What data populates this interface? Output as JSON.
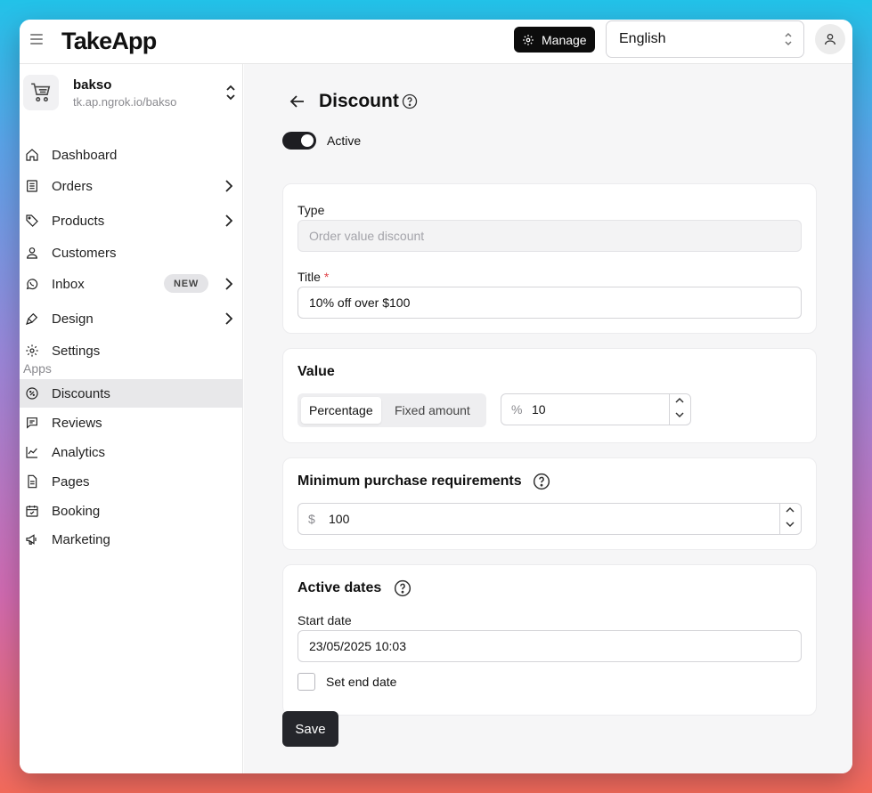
{
  "app": {
    "logo": "TakeApp"
  },
  "topbar": {
    "manage_label": "Manage",
    "language": "English"
  },
  "store": {
    "name": "bakso",
    "url": "tk.ap.ngrok.io/bakso"
  },
  "sidebar": {
    "items": [
      {
        "label": "Dashboard",
        "icon": "home-icon"
      },
      {
        "label": "Orders",
        "icon": "receipt-icon"
      },
      {
        "label": "Products",
        "icon": "tag-icon"
      },
      {
        "label": "Customers",
        "icon": "user-icon"
      },
      {
        "label": "Inbox",
        "icon": "whatsapp-icon",
        "badge": "NEW"
      },
      {
        "label": "Design",
        "icon": "brush-icon"
      },
      {
        "label": "Settings",
        "icon": "gear-icon"
      }
    ],
    "apps_label": "Apps",
    "apps": [
      {
        "label": "Discounts",
        "icon": "discount-icon"
      },
      {
        "label": "Reviews",
        "icon": "chat-icon"
      },
      {
        "label": "Analytics",
        "icon": "chart-icon"
      },
      {
        "label": "Pages",
        "icon": "document-icon"
      },
      {
        "label": "Booking",
        "icon": "calendar-icon"
      },
      {
        "label": "Marketing",
        "icon": "megaphone-icon"
      }
    ]
  },
  "page": {
    "title": "Discount",
    "active_label": "Active"
  },
  "type_card": {
    "type_label": "Type",
    "type_value": "Order value discount",
    "title_label": "Title",
    "title_required": "*",
    "title_value": "10% off over $100"
  },
  "value_card": {
    "title": "Value",
    "option_percentage": "Percentage",
    "option_fixed": "Fixed amount",
    "unit": "%",
    "amount": "10"
  },
  "minimum_card": {
    "title": "Minimum purchase requirements",
    "currency": "$",
    "amount": "100"
  },
  "dates_card": {
    "title": "Active dates",
    "start_label": "Start date",
    "start_value": "23/05/2025 10:03",
    "end_label": "Set end date"
  },
  "actions": {
    "save_label": "Save"
  }
}
